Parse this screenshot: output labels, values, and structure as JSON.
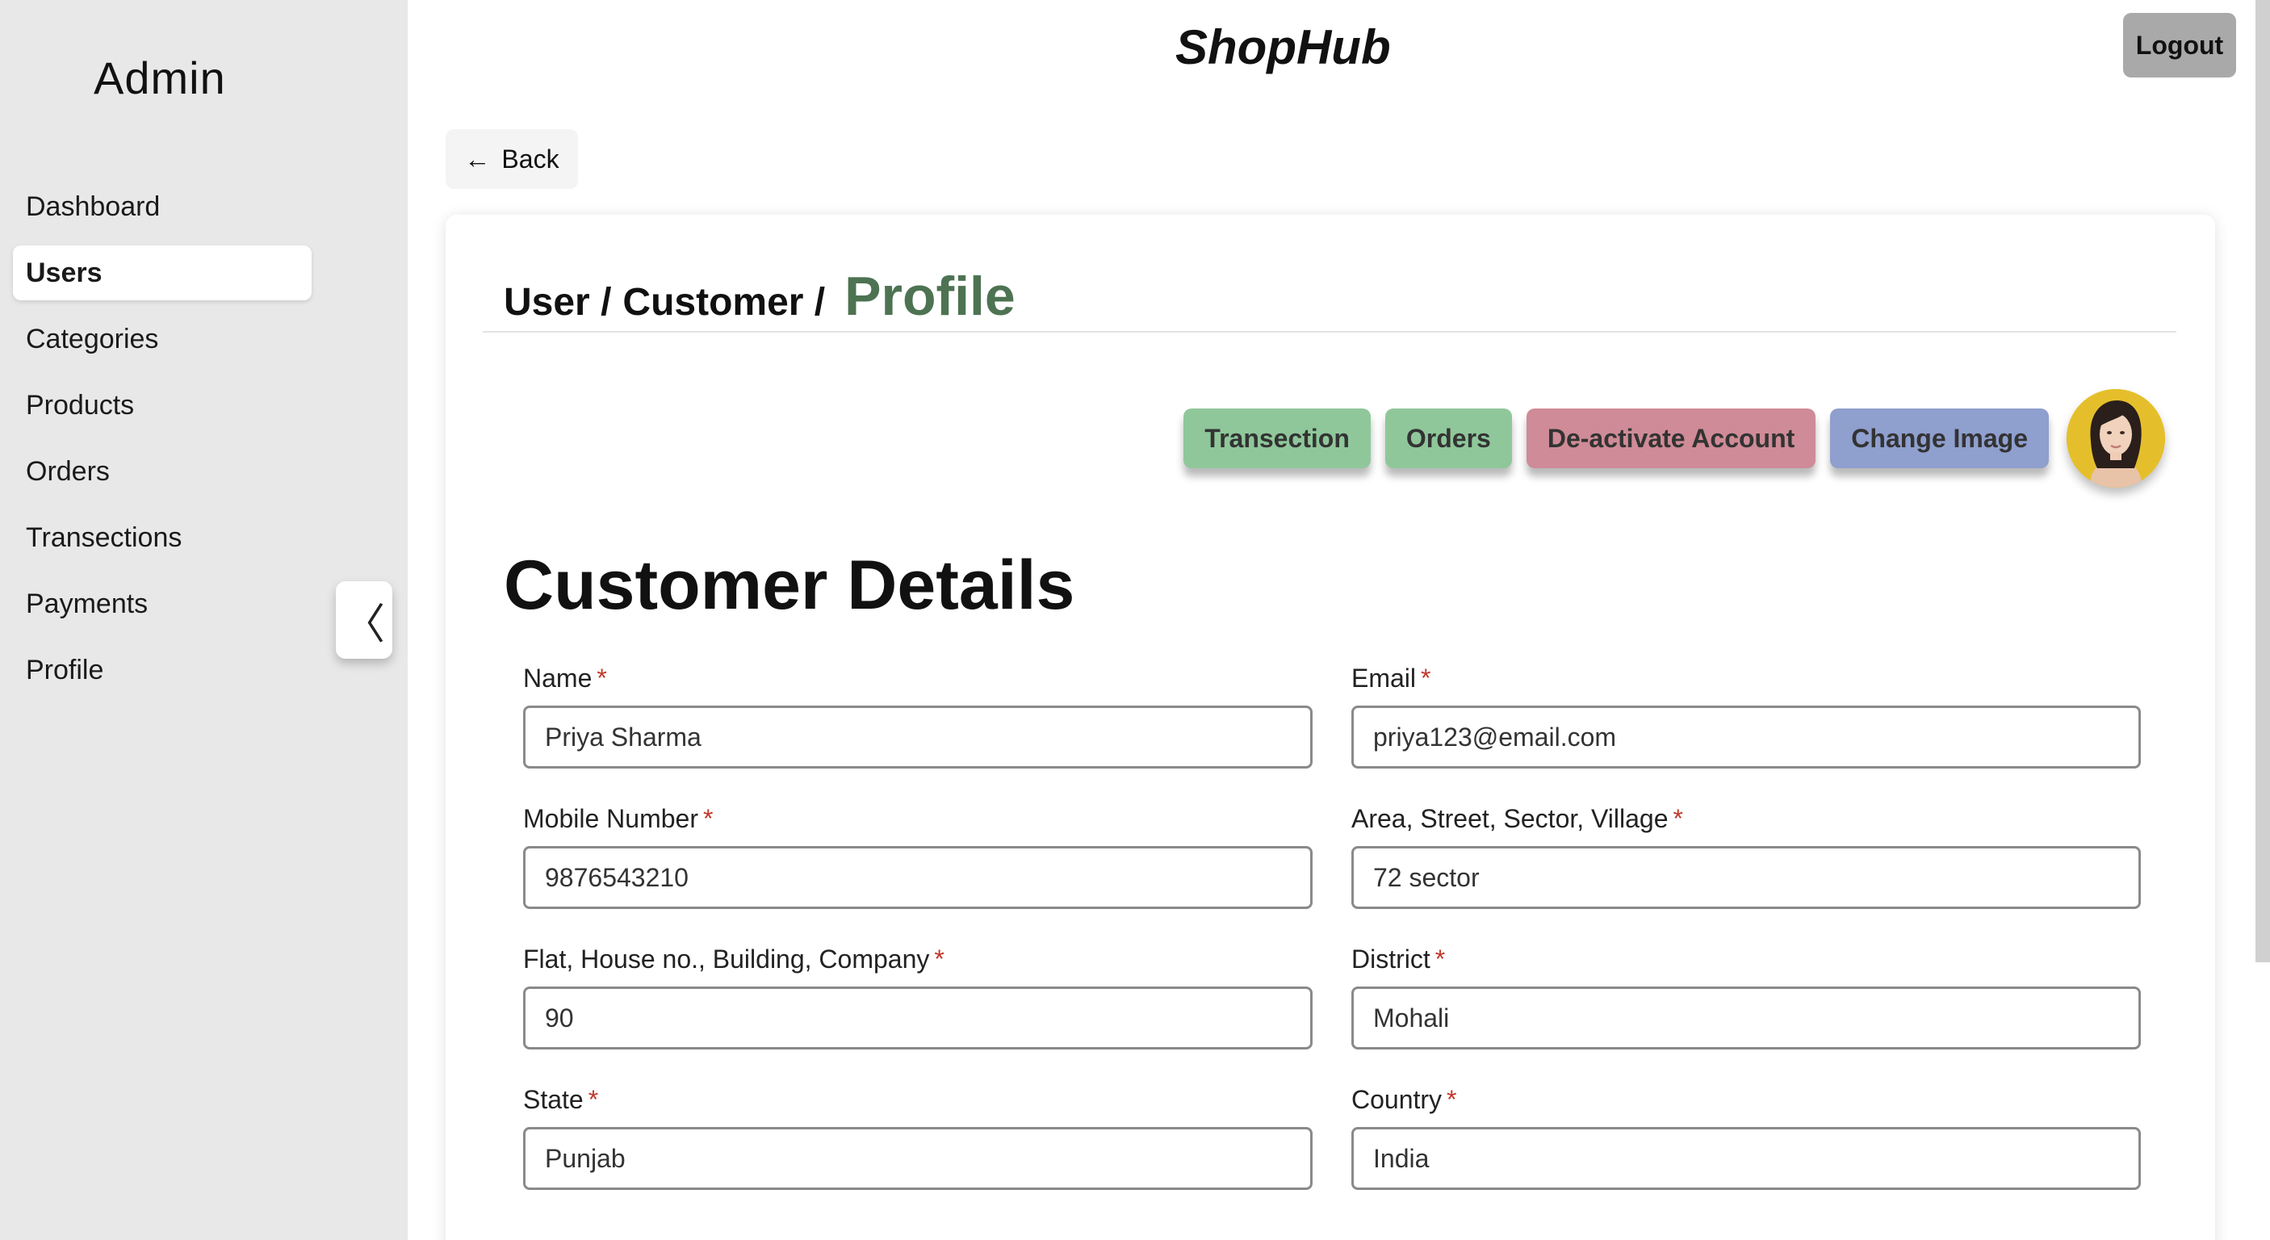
{
  "sidebar": {
    "brand": "Admin",
    "items": [
      {
        "label": "Dashboard"
      },
      {
        "label": "Users",
        "active": true
      },
      {
        "label": "Categories"
      },
      {
        "label": "Products"
      },
      {
        "label": "Orders"
      },
      {
        "label": "Transections"
      },
      {
        "label": "Payments"
      },
      {
        "label": "Profile"
      }
    ],
    "collapse_icon": "〈"
  },
  "header": {
    "title": "ShopHub",
    "logout_label": "Logout",
    "back_label": "Back",
    "back_icon": "←"
  },
  "breadcrumb": {
    "part1": "User /",
    "part2": "Customer /",
    "current": "Profile"
  },
  "actions": {
    "transection_label": "Transection",
    "orders_label": "Orders",
    "deactivate_label": "De-activate Account",
    "change_image_label": "Change Image"
  },
  "colors": {
    "green": "#8fc79a",
    "red": "#cf8b97",
    "blue": "#8f9fce",
    "breadcrumb_accent": "#4d7352"
  },
  "section_title": "Customer Details",
  "form": {
    "required_mark": "*",
    "name": {
      "label": "Name",
      "value": "Priya Sharma"
    },
    "email": {
      "label": "Email",
      "value": "priya123@email.com"
    },
    "mobile": {
      "label": "Mobile Number",
      "value": "9876543210"
    },
    "area": {
      "label": "Area, Street, Sector, Village",
      "value": "72 sector"
    },
    "flat": {
      "label": "Flat, House no., Building, Company",
      "value": "90"
    },
    "district": {
      "label": "District",
      "value": "Mohali"
    },
    "state": {
      "label": "State",
      "value": "Punjab"
    },
    "country": {
      "label": "Country",
      "value": "India"
    }
  }
}
